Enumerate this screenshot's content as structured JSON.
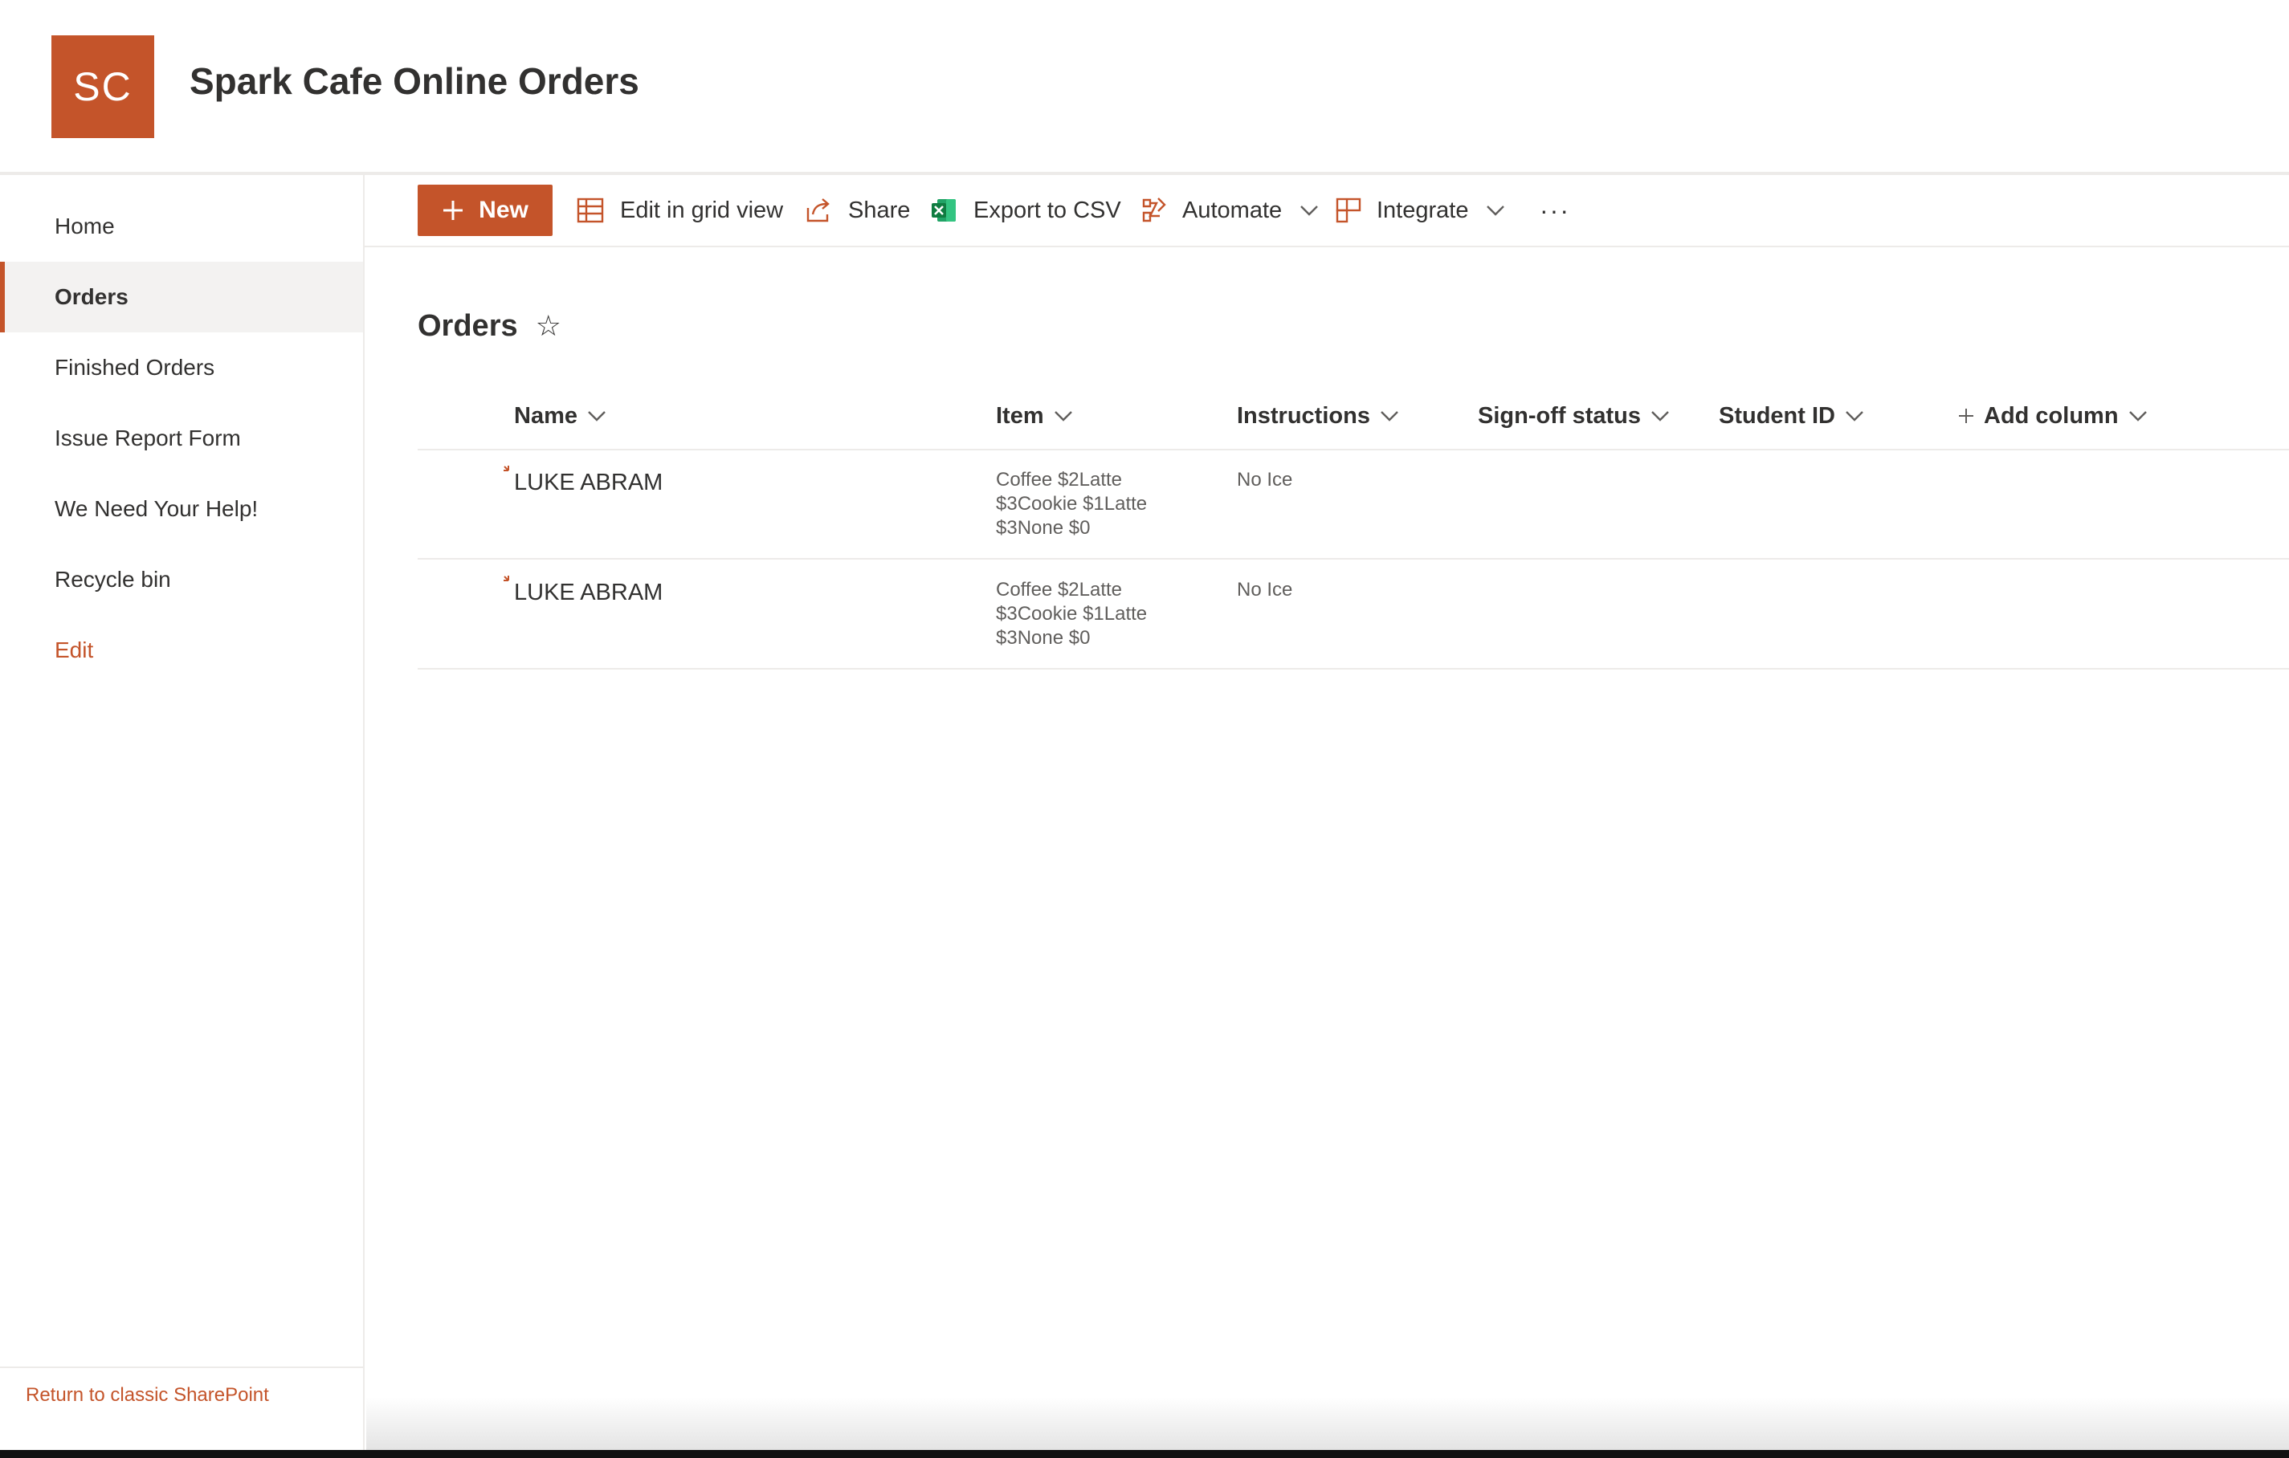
{
  "site": {
    "logo_initials": "SC",
    "title": "Spark Cafe Online Orders",
    "accent_color": "#c4542a"
  },
  "nav": {
    "items": [
      {
        "label": "Home",
        "selected": false
      },
      {
        "label": "Orders",
        "selected": true
      },
      {
        "label": "Finished Orders",
        "selected": false
      },
      {
        "label": "Issue Report Form",
        "selected": false
      },
      {
        "label": "We Need Your Help!",
        "selected": false
      },
      {
        "label": "Recycle bin",
        "selected": false
      }
    ],
    "edit_label": "Edit",
    "classic_link": "Return to classic SharePoint"
  },
  "commands": {
    "new_label": "New",
    "grid_label": "Edit in grid view",
    "share_label": "Share",
    "export_label": "Export to CSV",
    "automate_label": "Automate",
    "integrate_label": "Integrate",
    "more_label": "···"
  },
  "list": {
    "title": "Orders",
    "favorite_icon": "☆",
    "columns": {
      "name": "Name",
      "item": "Item",
      "instructions": "Instructions",
      "signoff": "Sign-off status",
      "student_id": "Student ID",
      "add_column": "Add column"
    },
    "rows": [
      {
        "name": "LUKE ABRAM",
        "item": "Coffee $2Latte $3Cookie $1Latte $3None $0",
        "instructions": "No Ice",
        "signoff": "",
        "student_id": ""
      },
      {
        "name": "LUKE ABRAM",
        "item": "Coffee $2Latte $3Cookie $1Latte $3None $0",
        "instructions": "No Ice",
        "signoff": "",
        "student_id": ""
      }
    ]
  }
}
